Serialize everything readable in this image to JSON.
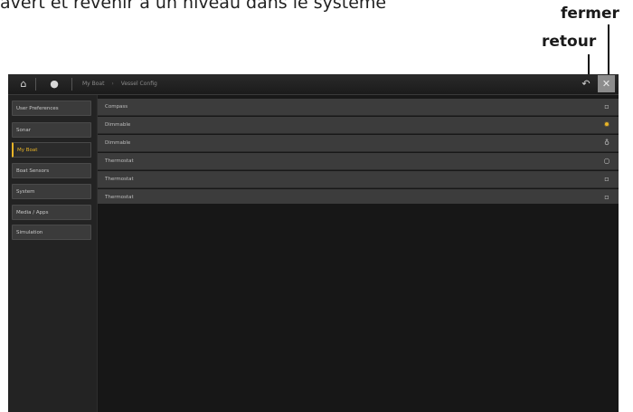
{
  "caption": "avert et revenir à un niveau dans le système",
  "callouts": {
    "close": "fermer",
    "back": "retour"
  },
  "topbar": {
    "home_icon": "home-icon",
    "bulb_icon": "lightbulb-icon",
    "breadcrumb": [
      "My Boat",
      "Vessel Config"
    ],
    "breadcrumb_separator": "›",
    "back_icon": "back-arrow-icon",
    "close_icon": "close-icon"
  },
  "sidebar": {
    "items": [
      {
        "label": "User Preferences",
        "active": false
      },
      {
        "label": "Sonar",
        "active": false
      },
      {
        "label": "My Boat",
        "active": true
      },
      {
        "label": "Boat Sensors",
        "active": false
      },
      {
        "label": "System",
        "active": false
      },
      {
        "label": "Media / Apps",
        "active": false
      },
      {
        "label": "Simulation",
        "active": false
      }
    ]
  },
  "main": {
    "rows": [
      {
        "label": "Compass",
        "icon": "square-icon",
        "icon_glyph": "▫",
        "on": false
      },
      {
        "label": "Dimmable",
        "icon": "sun-icon",
        "icon_glyph": "✹",
        "on": true
      },
      {
        "label": "Dimmable",
        "icon": "bulb-icon",
        "icon_glyph": "♁",
        "on": false
      },
      {
        "label": "Thermostat",
        "icon": "bulb-icon",
        "icon_glyph": "○",
        "on": false
      },
      {
        "label": "Thermostat",
        "icon": "square-icon",
        "icon_glyph": "▫",
        "on": false
      },
      {
        "label": "Thermostat",
        "icon": "square-icon",
        "icon_glyph": "▫",
        "on": false
      }
    ]
  },
  "colors": {
    "accent": "#e8b427",
    "row_bg": "#3c3c3c",
    "screen_bg": "#121212"
  }
}
